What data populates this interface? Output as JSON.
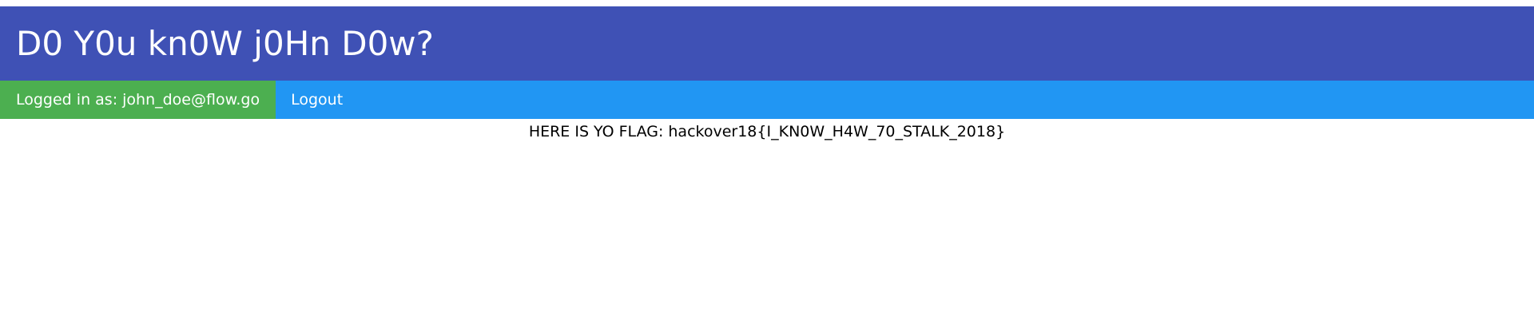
{
  "header": {
    "title": "D0 Y0u kn0W j0Hn D0w?",
    "bg_color": "#3f51b5"
  },
  "navbar": {
    "logged_in_label": "Logged in as: john_doe@flow.go",
    "logout_label": "Logout",
    "bg_color": "#2196f3",
    "user_bg_color": "#4caf50"
  },
  "content": {
    "flag_prefix": "HERE IS YO FLAG: hackover18",
    "flag_open_brace": "{",
    "flag_value": "I_KN0W_H4W_70_STALK_2018",
    "flag_close_brace": "}"
  }
}
